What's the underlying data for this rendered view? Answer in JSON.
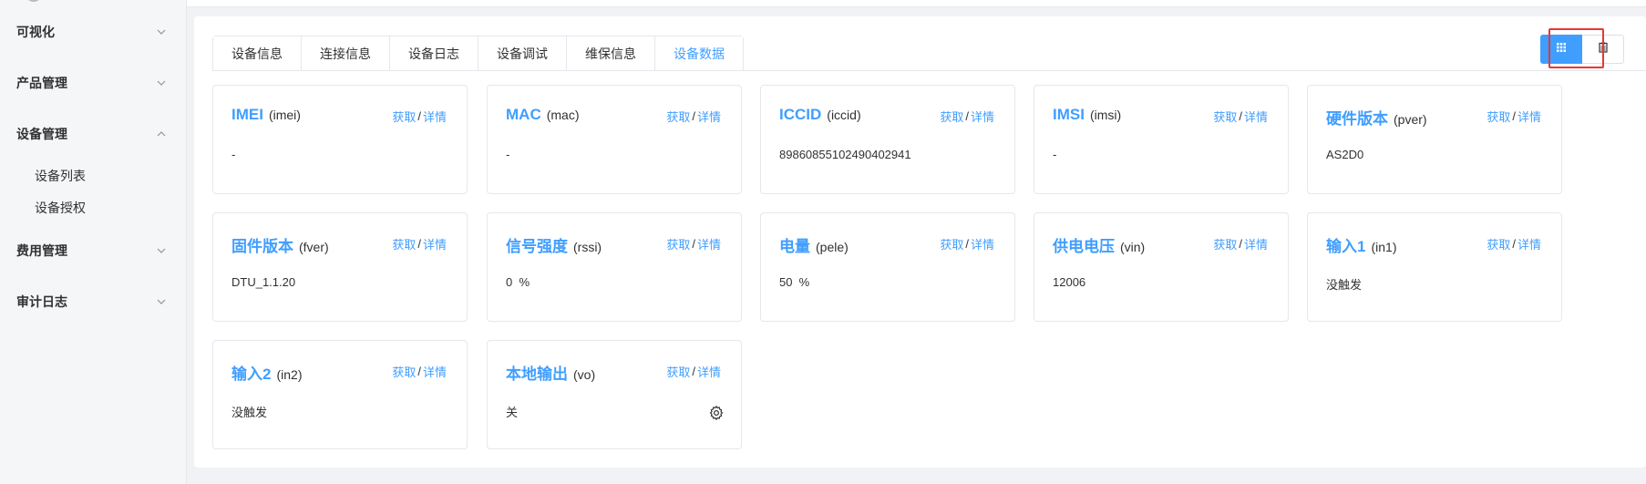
{
  "sidebar": {
    "items": [
      {
        "label": "可视化"
      },
      {
        "label": "产品管理"
      },
      {
        "label": "设备管理"
      },
      {
        "label": "费用管理"
      },
      {
        "label": "审计日志"
      }
    ],
    "sub_items": [
      {
        "label": "设备列表"
      },
      {
        "label": "设备授权"
      }
    ]
  },
  "tabs": [
    {
      "label": "设备信息"
    },
    {
      "label": "连接信息"
    },
    {
      "label": "设备日志"
    },
    {
      "label": "设备调试"
    },
    {
      "label": "维保信息"
    },
    {
      "label": "设备数据"
    }
  ],
  "active_tab": "设备数据",
  "actions": {
    "fetch": "获取",
    "separator": "/",
    "detail": "详情"
  },
  "cards": [
    {
      "name": "IMEI",
      "code": "(imei)",
      "value": "-"
    },
    {
      "name": "MAC",
      "code": "(mac)",
      "value": "-"
    },
    {
      "name": "ICCID",
      "code": "(iccid)",
      "value": "89860855102490402941"
    },
    {
      "name": "IMSI",
      "code": "(imsi)",
      "value": "-"
    },
    {
      "name": "硬件版本",
      "code": "(pver)",
      "value": "AS2D0"
    },
    {
      "name": "固件版本",
      "code": "(fver)",
      "value": "DTU_1.1.20"
    },
    {
      "name": "信号强度",
      "code": "(rssi)",
      "value": "0  %"
    },
    {
      "name": "电量",
      "code": "(pele)",
      "value": "50  %"
    },
    {
      "name": "供电电压",
      "code": "(vin)",
      "value": "12006"
    },
    {
      "name": "输入1",
      "code": "(in1)",
      "value": "没触发"
    },
    {
      "name": "输入2",
      "code": "(in2)",
      "value": "没触发"
    },
    {
      "name": "本地输出",
      "code": "(vo)",
      "value": "关"
    }
  ],
  "colors": {
    "accent": "#409eff",
    "highlight": "#e53935"
  },
  "icons": {
    "grid_view": "grid-icon",
    "list_view": "list-icon",
    "settings": "gear-icon"
  }
}
